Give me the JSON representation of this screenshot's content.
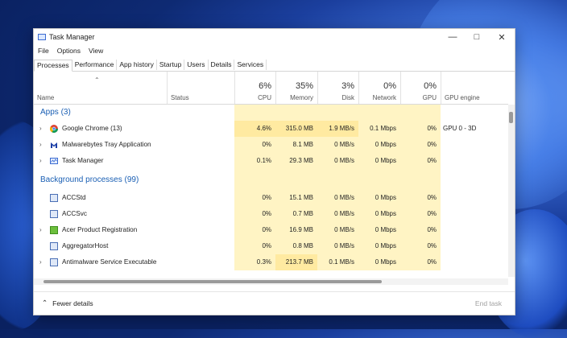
{
  "window": {
    "title": "Task Manager"
  },
  "menu": [
    "File",
    "Options",
    "View"
  ],
  "tabs": [
    "Processes",
    "Performance",
    "App history",
    "Startup",
    "Users",
    "Details",
    "Services"
  ],
  "columns": {
    "name": "Name",
    "status": "Status",
    "cpu": {
      "pct": "6%",
      "label": "CPU"
    },
    "memory": {
      "pct": "35%",
      "label": "Memory"
    },
    "disk": {
      "pct": "3%",
      "label": "Disk"
    },
    "network": {
      "pct": "0%",
      "label": "Network"
    },
    "gpu": {
      "pct": "0%",
      "label": "GPU"
    },
    "gpu_engine": "GPU engine"
  },
  "groups": {
    "apps": "Apps (3)",
    "background": "Background processes (99)"
  },
  "apps": [
    {
      "name": "Google Chrome (13)",
      "cpu": "4.6%",
      "memory": "315.0 MB",
      "disk": "1.9 MB/s",
      "network": "0.1 Mbps",
      "gpu": "0%",
      "gpu_engine": "GPU 0 - 3D",
      "icon": "chrome-icon"
    },
    {
      "name": "Malwarebytes Tray Application",
      "cpu": "0%",
      "memory": "8.1 MB",
      "disk": "0 MB/s",
      "network": "0 Mbps",
      "gpu": "0%",
      "gpu_engine": "",
      "icon": "malwarebytes-icon"
    },
    {
      "name": "Task Manager",
      "cpu": "0.1%",
      "memory": "29.3 MB",
      "disk": "0 MB/s",
      "network": "0 Mbps",
      "gpu": "0%",
      "gpu_engine": "",
      "icon": "task-manager-icon"
    }
  ],
  "background": [
    {
      "name": "ACCStd",
      "cpu": "0%",
      "memory": "15.1 MB",
      "disk": "0 MB/s",
      "network": "0 Mbps",
      "gpu": "0%",
      "gpu_engine": ""
    },
    {
      "name": "ACCSvc",
      "cpu": "0%",
      "memory": "0.7 MB",
      "disk": "0 MB/s",
      "network": "0 Mbps",
      "gpu": "0%",
      "gpu_engine": ""
    },
    {
      "name": "Acer Product Registration",
      "cpu": "0%",
      "memory": "16.9 MB",
      "disk": "0 MB/s",
      "network": "0 Mbps",
      "gpu": "0%",
      "gpu_engine": ""
    },
    {
      "name": "AggregatorHost",
      "cpu": "0%",
      "memory": "0.8 MB",
      "disk": "0 MB/s",
      "network": "0 Mbps",
      "gpu": "0%",
      "gpu_engine": ""
    },
    {
      "name": "Antimalware Service Executable",
      "cpu": "0.3%",
      "memory": "213.7 MB",
      "disk": "0.1 MB/s",
      "network": "0 Mbps",
      "gpu": "0%",
      "gpu_engine": ""
    }
  ],
  "footer": {
    "fewer_details": "Fewer details",
    "end_task": "End task"
  },
  "colors": {
    "heat_light": "#fff4c4",
    "heat_mid": "#ffeaa1",
    "group_title": "#1a5fb4"
  }
}
